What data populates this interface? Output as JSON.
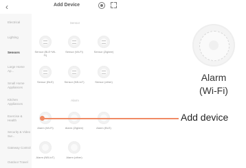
{
  "header": {
    "back_icon": "chevron-left-icon",
    "title": "Add Device",
    "scan_icon": "scan-icon",
    "qr_icon": "qr-code-icon"
  },
  "sidebar": {
    "items": [
      {
        "label": "Electrical"
      },
      {
        "label": "Lighting"
      },
      {
        "label": "Sensors",
        "active": true
      },
      {
        "label": "Large Home Ap..."
      },
      {
        "label": "Small Home Appliances"
      },
      {
        "label": "Kitchen Appliances"
      },
      {
        "label": "Exercise & Health"
      },
      {
        "label": "Security & Video Sur..."
      },
      {
        "label": "Gateway Control"
      },
      {
        "label": "Outdoor Travel"
      }
    ]
  },
  "groups": {
    "sensor_title": "Sensor",
    "alarm_title": "Alarm"
  },
  "devices": [
    {
      "label": "Sensor (BLE+Wi-Fi)"
    },
    {
      "label": "Sensor (Wi-Fi)"
    },
    {
      "label": "Sensor (Zigbee)"
    },
    {
      "label": "Sensor (BLE)"
    },
    {
      "label": "Sensor (NB-IoT)"
    },
    {
      "label": "Sensor (other)"
    },
    {
      "label": "Alarm (Wi-Fi)"
    },
    {
      "label": "Alarm (Zigbee)"
    },
    {
      "label": "Alarm (BLE)"
    },
    {
      "label": "Alarm (NB-IoT)"
    },
    {
      "label": "Alarm (other)"
    }
  ],
  "callout": {
    "label_line1": "Alarm",
    "label_line2": "(Wi-Fi)",
    "annotation": "Add device",
    "accent_color": "#f08a64"
  }
}
